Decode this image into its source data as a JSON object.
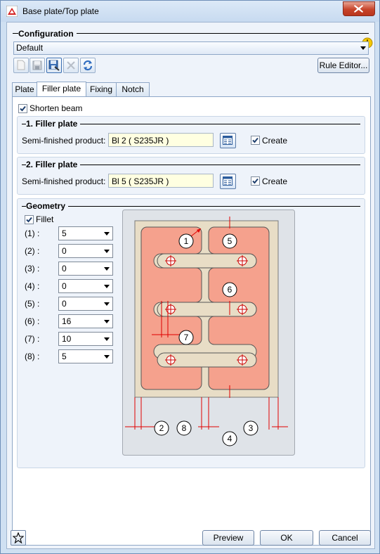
{
  "window": {
    "title": "Base plate/Top plate"
  },
  "configuration": {
    "heading": "Configuration",
    "selected": "Default",
    "rule_editor_label": "Rule Editor..."
  },
  "tabs": [
    "Plate",
    "Filler plate",
    "Fixing",
    "Notch"
  ],
  "shorten_beam": {
    "label": "Shorten beam",
    "checked": true
  },
  "filler1": {
    "heading": "1. Filler plate",
    "product_label": "Semi-finished product:",
    "product_value": "Bl 2  ( S235JR )",
    "create_label": "Create",
    "create_checked": true
  },
  "filler2": {
    "heading": "2. Filler plate",
    "product_label": "Semi-finished product:",
    "product_value": "Bl 5  ( S235JR )",
    "create_label": "Create",
    "create_checked": true
  },
  "geometry": {
    "heading": "Geometry",
    "fillet_label": "Fillet",
    "fillet_checked": true,
    "fields": [
      {
        "label": "(1) :",
        "value": "5"
      },
      {
        "label": "(2) :",
        "value": "0"
      },
      {
        "label": "(3) :",
        "value": "0"
      },
      {
        "label": "(4) :",
        "value": "0"
      },
      {
        "label": "(5) :",
        "value": "0"
      },
      {
        "label": "(6) :",
        "value": "16"
      },
      {
        "label": "(7) :",
        "value": "10"
      },
      {
        "label": "(8) :",
        "value": "5"
      }
    ]
  },
  "diagram_labels": {
    "n1": "1",
    "n2": "2",
    "n3": "3",
    "n4": "4",
    "n5": "5",
    "n6": "6",
    "n7": "7",
    "n8": "8"
  },
  "footer": {
    "preview": "Preview",
    "ok": "OK",
    "cancel": "Cancel"
  },
  "colors": {
    "plate_fill": "#f5a18d",
    "filler_fill": "#e8ddc6",
    "dim_line": "#e00000",
    "accent": "#3a78c8"
  }
}
